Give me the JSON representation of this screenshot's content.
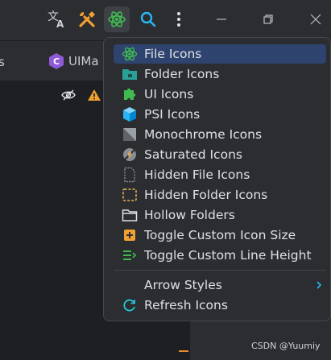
{
  "tabs": {
    "left_partial": "s",
    "current_partial": "UIMa"
  },
  "menu": {
    "items": [
      {
        "label": "File Icons",
        "icon": "atom-icon",
        "selected": true
      },
      {
        "label": "Folder Icons",
        "icon": "folder-icon"
      },
      {
        "label": "UI Icons",
        "icon": "puzzle-icon"
      },
      {
        "label": "PSI Icons",
        "icon": "cube-icon"
      },
      {
        "label": "Monochrome Icons",
        "icon": "monochrome-icon"
      },
      {
        "label": "Saturated Icons",
        "icon": "saturated-icon"
      },
      {
        "label": "Hidden File Icons",
        "icon": "hidden-file-icon"
      },
      {
        "label": "Hidden Folder Icons",
        "icon": "hidden-folder-icon"
      },
      {
        "label": "Hollow Folders",
        "icon": "hollow-folder-icon"
      },
      {
        "label": "Toggle Custom Icon Size",
        "icon": "plus-box-icon"
      },
      {
        "label": "Toggle Custom Line Height",
        "icon": "line-height-icon"
      }
    ],
    "arrow_styles": "Arrow Styles",
    "refresh_icons": "Refresh Icons"
  },
  "watermark": "CSDN @Yuumiy",
  "colors": {
    "selection": "#2e436e",
    "atom": "#3fb950",
    "folder": "#2aa198",
    "puzzle": "#3fb950",
    "cube": "#29b6f6",
    "accent_orange": "#f0a030",
    "refresh": "#26c6da"
  }
}
